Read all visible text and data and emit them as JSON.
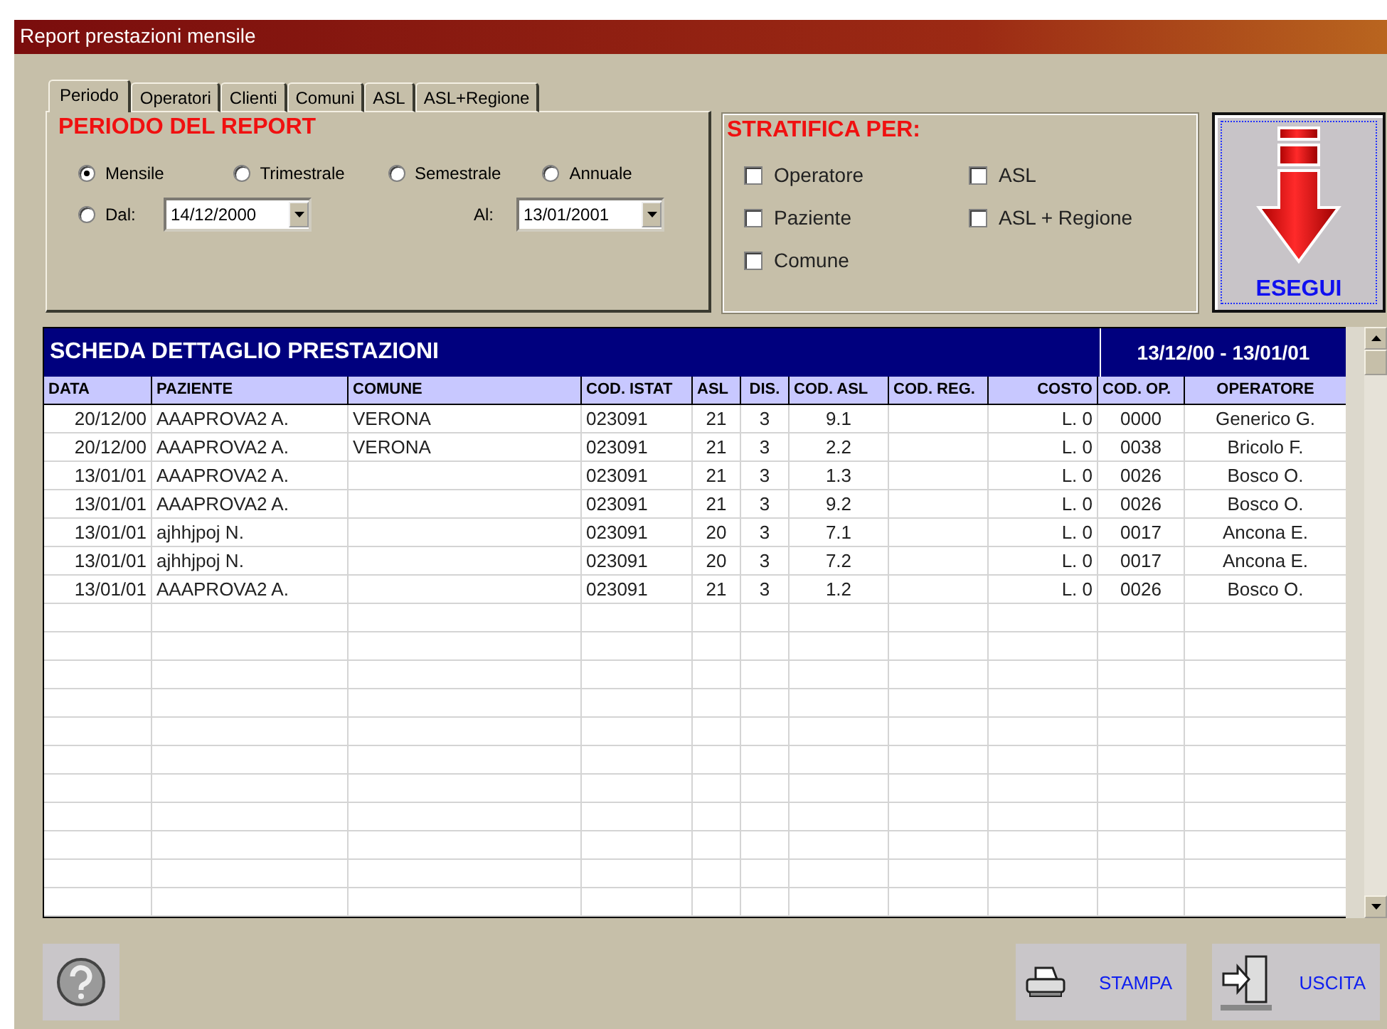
{
  "window": {
    "title": "Report prestazioni mensile"
  },
  "tabs": [
    {
      "label": "Periodo",
      "selected": true
    },
    {
      "label": "Operatori",
      "selected": false
    },
    {
      "label": "Clienti",
      "selected": false
    },
    {
      "label": "Comuni",
      "selected": false
    },
    {
      "label": "ASL",
      "selected": false
    },
    {
      "label": "ASL+Regione",
      "selected": false
    }
  ],
  "period": {
    "heading": "PERIODO DEL REPORT",
    "options": [
      {
        "label": "Mensile",
        "selected": true
      },
      {
        "label": "Trimestrale",
        "selected": false
      },
      {
        "label": "Semestrale",
        "selected": false
      },
      {
        "label": "Annuale",
        "selected": false
      }
    ],
    "range": {
      "label": "Dal:",
      "selected": false,
      "from": "14/12/2000",
      "to_label": "Al:",
      "to": "13/01/2001"
    }
  },
  "stratify": {
    "heading": "STRATIFICA PER:",
    "columns": [
      [
        {
          "label": "Operatore",
          "checked": false
        },
        {
          "label": "Paziente",
          "checked": false
        },
        {
          "label": "Comune",
          "checked": false
        }
      ],
      [
        {
          "label": "ASL",
          "checked": false
        },
        {
          "label": "ASL + Regione",
          "checked": false
        }
      ]
    ]
  },
  "run_button": {
    "label": "ESEGUI"
  },
  "table": {
    "title": "SCHEDA DETTAGLIO PRESTAZIONI",
    "range": "13/12/00 - 13/01/01",
    "columns": [
      "DATA",
      "PAZIENTE",
      "COMUNE",
      "COD. ISTAT",
      "ASL",
      "DIS.",
      "COD. ASL",
      "COD. REG.",
      "COSTO",
      "COD. OP.",
      "OPERATORE"
    ],
    "rows": [
      [
        "20/12/00",
        "AAAPROVA2 A.",
        "VERONA",
        "023091",
        "21",
        "3",
        "9.1",
        "",
        "L. 0",
        "0000",
        "Generico G."
      ],
      [
        "20/12/00",
        "AAAPROVA2 A.",
        "VERONA",
        "023091",
        "21",
        "3",
        "2.2",
        "",
        "L. 0",
        "0038",
        "Bricolo F."
      ],
      [
        "13/01/01",
        "AAAPROVA2 A.",
        "",
        "023091",
        "21",
        "3",
        "1.3",
        "",
        "L. 0",
        "0026",
        "Bosco O."
      ],
      [
        "13/01/01",
        "AAAPROVA2 A.",
        "",
        "023091",
        "21",
        "3",
        "9.2",
        "",
        "L. 0",
        "0026",
        "Bosco O."
      ],
      [
        "13/01/01",
        "ajhhjpoj N.",
        "",
        "023091",
        "20",
        "3",
        "7.1",
        "",
        "L. 0",
        "0017",
        "Ancona E."
      ],
      [
        "13/01/01",
        "ajhhjpoj N.",
        "",
        "023091",
        "20",
        "3",
        "7.2",
        "",
        "L. 0",
        "0017",
        "Ancona E."
      ],
      [
        "13/01/01",
        "AAAPROVA2 A.",
        "",
        "023091",
        "21",
        "3",
        "1.2",
        "",
        "L. 0",
        "0026",
        "Bosco O."
      ]
    ]
  },
  "footer": {
    "print": "STAMPA",
    "exit": "USCITA"
  }
}
